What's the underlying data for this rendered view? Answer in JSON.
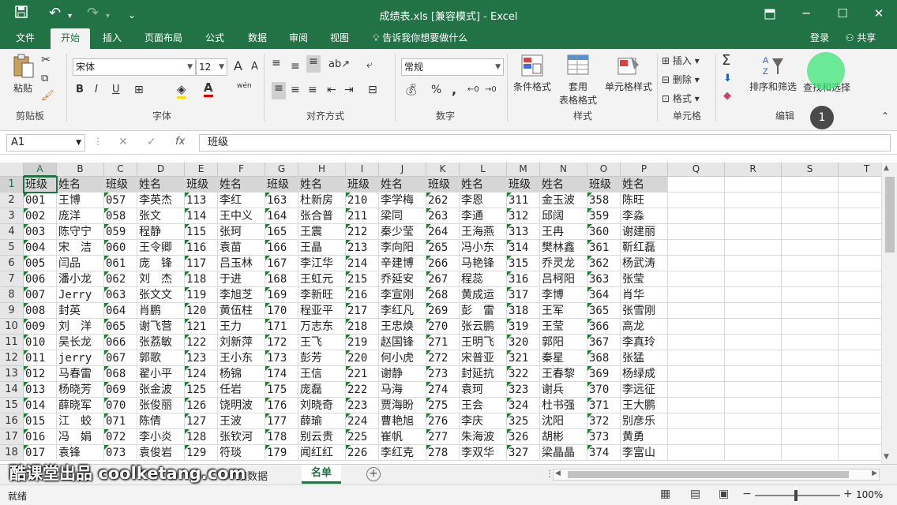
{
  "window": {
    "title": "成绩表.xls  [兼容模式]  -  Excel"
  },
  "ribbon_tabs": [
    "文件",
    "开始",
    "插入",
    "页面布局",
    "公式",
    "数据",
    "审阅",
    "视图"
  ],
  "active_tab": "开始",
  "tellme": "告诉我你想要做什么",
  "account": {
    "login": "登录",
    "share": "共享"
  },
  "ribbon": {
    "clipboard": {
      "label": "剪贴板",
      "paste": "粘贴"
    },
    "font": {
      "label": "字体",
      "name": "宋体",
      "size": "12",
      "bold": "B",
      "italic": "I",
      "underline": "U",
      "grow": "A",
      "shrink": "A",
      "phonetic": "wén"
    },
    "alignment": {
      "label": "对齐方式"
    },
    "number": {
      "label": "数字",
      "format": "常规",
      "percent": "%",
      "comma": ","
    },
    "styles": {
      "label": "样式",
      "conditional": "条件格式",
      "table_line1": "套用",
      "table_line2": "表格格式",
      "cell_styles": "单元格样式"
    },
    "cells": {
      "label": "单元格",
      "insert": "插入",
      "delete": "删除",
      "format": "格式"
    },
    "editing": {
      "label": "编辑",
      "sum": "Σ",
      "sort": "排序和筛选",
      "find": "查找和选择"
    }
  },
  "formula_bar": {
    "name_box": "A1",
    "fx": "fx",
    "content": "班级"
  },
  "columns": [
    "A",
    "B",
    "C",
    "D",
    "E",
    "F",
    "G",
    "H",
    "I",
    "J",
    "K",
    "L",
    "M",
    "N",
    "O",
    "P",
    "Q",
    "R",
    "S",
    "T"
  ],
  "rows": [
    [
      "班级",
      "姓名",
      "班级",
      "姓名",
      "班级",
      "姓名",
      "班级",
      "姓名",
      "班级",
      "姓名",
      "班级",
      "姓名",
      "班级",
      "姓名",
      "班级",
      "姓名"
    ],
    [
      "001",
      "王博",
      "057",
      "李英杰",
      "113",
      "李红",
      "163",
      "杜新房",
      "210",
      "李学梅",
      "262",
      "李恩",
      "311",
      "金玉波",
      "358",
      "陈旺"
    ],
    [
      "002",
      "庞洋",
      "058",
      "张文",
      "114",
      "王中义",
      "164",
      "张合普",
      "211",
      "梁同",
      "263",
      "李通",
      "312",
      "邱阔",
      "359",
      "李淼"
    ],
    [
      "003",
      "陈守宁",
      "059",
      "程静",
      "115",
      "张珂",
      "165",
      "王震",
      "212",
      "秦少莹",
      "264",
      "王海燕",
      "313",
      "王冉",
      "360",
      "谢建丽"
    ],
    [
      "004",
      "宋　洁",
      "060",
      "王令卿",
      "116",
      "袁苗",
      "166",
      "王晶",
      "213",
      "李向阳",
      "265",
      "冯小东",
      "314",
      "樊林鑫",
      "361",
      "靳红磊"
    ],
    [
      "005",
      "闫品",
      "061",
      "庞　锋",
      "117",
      "吕玉林",
      "167",
      "李江华",
      "214",
      "辛建博",
      "266",
      "马艳锋",
      "315",
      "乔灵龙",
      "362",
      "杨武涛"
    ],
    [
      "006",
      "潘小龙",
      "062",
      "刘　杰",
      "118",
      "于进",
      "168",
      "王虹元",
      "215",
      "乔延安",
      "267",
      "程蕊",
      "316",
      "吕柯阳",
      "363",
      "张莹"
    ],
    [
      "007",
      "Jerry",
      "063",
      "张文文",
      "119",
      "李旭芝",
      "169",
      "李新旺",
      "216",
      "李宣刚",
      "268",
      "黄成运",
      "317",
      "李博",
      "364",
      "肖华"
    ],
    [
      "008",
      "封英",
      "064",
      "肖鹏",
      "120",
      "黄伍柱",
      "170",
      "程亚平",
      "217",
      "李红凡",
      "269",
      "彭　雷",
      "318",
      "王军",
      "365",
      "张雪刚"
    ],
    [
      "009",
      "刘　洋",
      "065",
      "谢飞营",
      "121",
      "王力",
      "171",
      "万志东",
      "218",
      "王忠焕",
      "270",
      "张云鹏",
      "319",
      "王莹",
      "366",
      "高龙"
    ],
    [
      "010",
      "吴长龙",
      "066",
      "张荔敏",
      "122",
      "刘新萍",
      "172",
      "王飞",
      "219",
      "赵国锋",
      "271",
      "王明飞",
      "320",
      "郭阳",
      "367",
      "李真玲"
    ],
    [
      "011",
      "jerry",
      "067",
      "郭歌",
      "123",
      "王小东",
      "173",
      "彭芳",
      "220",
      "何小虎",
      "272",
      "宋普亚",
      "321",
      "秦星",
      "368",
      "张猛"
    ],
    [
      "012",
      "马春雷",
      "068",
      "翟小平",
      "124",
      "杨锦",
      "174",
      "王信",
      "221",
      "谢静",
      "273",
      "封延抗",
      "322",
      "王春黎",
      "369",
      "杨绿成"
    ],
    [
      "013",
      "杨晓芳",
      "069",
      "张金波",
      "125",
      "任岩",
      "175",
      "庞磊",
      "222",
      "马海",
      "274",
      "袁珂",
      "323",
      "谢兵",
      "370",
      "李远征"
    ],
    [
      "014",
      "薛晓军",
      "070",
      "张俊丽",
      "126",
      "饶明波",
      "176",
      "刘晓奇",
      "223",
      "贾海盼",
      "275",
      "王会",
      "324",
      "杜书强",
      "371",
      "王大鹏"
    ],
    [
      "015",
      "江　蛟",
      "071",
      "陈倩",
      "127",
      "王波",
      "177",
      "薛瑜",
      "224",
      "曹艳旭",
      "276",
      "李庆",
      "325",
      "沈阳",
      "372",
      "别彦乐"
    ],
    [
      "016",
      "冯　娟",
      "072",
      "李小炎",
      "128",
      "张钦河",
      "178",
      "别云贵",
      "225",
      "崔帆",
      "277",
      "朱海波",
      "326",
      "胡彬",
      "373",
      "黄勇"
    ],
    [
      "017",
      "袁锋",
      "073",
      "袁俊岩",
      "129",
      "符琰",
      "179",
      "闻红红",
      "226",
      "李红克",
      "278",
      "李双华",
      "327",
      "梁晶晶",
      "374",
      "李富山"
    ]
  ],
  "sheet_tabs": [
    "绩数据",
    "名单"
  ],
  "active_sheet": "名单",
  "status": {
    "ready": "就绪",
    "zoom": "100%"
  },
  "watermark": "酷课堂出品 coolketang.com",
  "step_badge": "1",
  "colors": {
    "accent": "#217346",
    "green_tri": "#1e7e34"
  }
}
